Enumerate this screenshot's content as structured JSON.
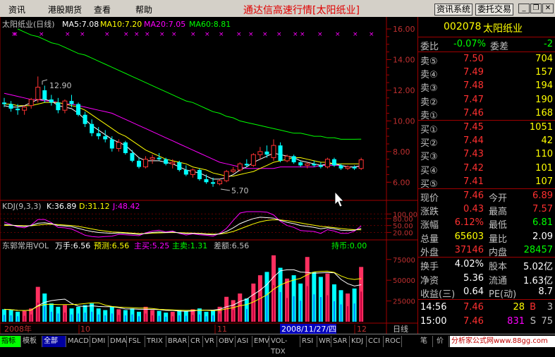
{
  "menubar": {
    "items": [
      "资讯",
      "港股期货",
      "查看",
      "帮助"
    ],
    "title": "通达信高速行情",
    "title_bracket": "[太阳纸业]",
    "btn_info": "资讯系统",
    "btn_trade": "委托交易"
  },
  "chart": {
    "main_label": "太阳纸业(日线)",
    "ma5": "MA5:7.08",
    "ma10": "MA10:7.20",
    "ma20": "MA20:7.05",
    "ma60": "MA60:8.81",
    "high_mark": "12.90",
    "low_mark": "5.70",
    "kdj_label": "KDJ(9,3,3)",
    "kdj_k": "K:36.89",
    "kdj_d": "D:31.12",
    "kdj_j": "J:48.42",
    "vol_name": "东郭常用VOL",
    "vol_wanshou": "万手:6.56",
    "vol_forecast": "预测:6.56",
    "vol_mainbuy": "主买:5.25",
    "vol_mainsell": "主卖:1.31",
    "vol_diff": "差额:6.56",
    "holding": "持币:0.00",
    "bottom_labels": {
      "y2008": "2008年",
      "m10": "10",
      "m11": "11",
      "cursor_date": "2008/11/27/四",
      "m12": "12",
      "period": "日线"
    },
    "colors": {
      "up": "#ff3333",
      "down": "#00ffff",
      "ma5": "#ffffff",
      "ma10": "#ffff00",
      "ma20": "#ff00ff",
      "ma60": "#00ff00",
      "axis": "#a00000",
      "axis_text": "#c03030"
    }
  },
  "chart_data": {
    "type": "candlestick",
    "price_axis": {
      "ticks": [
        "16.00",
        "14.00",
        "12.00",
        "10.00",
        "8.00",
        "6.00"
      ],
      "ylim": [
        5.0,
        16.6
      ]
    },
    "kdj_axis": {
      "ticks": [
        "100.00",
        "80.00",
        "50.00",
        "20.00"
      ],
      "ylim": [
        0,
        110
      ]
    },
    "vol_axis": {
      "ticks": [
        "75000",
        "50000",
        "25000"
      ],
      "ylim": [
        0,
        85000
      ]
    },
    "candles": [
      [
        11.2,
        11.5,
        10.9,
        11.1
      ],
      [
        11.1,
        11.3,
        10.6,
        10.8
      ],
      [
        10.8,
        11.1,
        10.4,
        10.7
      ],
      [
        10.7,
        11.0,
        10.4,
        10.9
      ],
      [
        11.0,
        11.5,
        10.8,
        11.4
      ],
      [
        11.4,
        12.9,
        11.2,
        12.2
      ],
      [
        12.0,
        12.3,
        11.2,
        11.4
      ],
      [
        11.4,
        11.7,
        11.0,
        11.2
      ],
      [
        11.2,
        11.5,
        10.5,
        10.7
      ],
      [
        10.7,
        11.4,
        10.5,
        11.3
      ],
      [
        11.3,
        11.7,
        10.9,
        11.1
      ],
      [
        11.1,
        11.2,
        10.3,
        10.4
      ],
      [
        10.4,
        10.6,
        9.6,
        9.8
      ],
      [
        9.8,
        10.1,
        9.0,
        9.2
      ],
      [
        9.2,
        9.6,
        8.8,
        9.0
      ],
      [
        9.0,
        9.4,
        8.6,
        8.8
      ],
      [
        8.8,
        9.0,
        8.0,
        8.2
      ],
      [
        8.2,
        8.8,
        8.0,
        8.6
      ],
      [
        8.6,
        8.7,
        7.8,
        7.9
      ],
      [
        7.9,
        8.1,
        7.3,
        7.4
      ],
      [
        7.4,
        7.6,
        6.9,
        7.0
      ],
      [
        7.0,
        7.7,
        6.9,
        7.5
      ],
      [
        7.5,
        7.8,
        7.2,
        7.6
      ],
      [
        7.6,
        7.9,
        7.4,
        7.5
      ],
      [
        7.5,
        7.6,
        7.1,
        7.2
      ],
      [
        7.2,
        7.5,
        6.9,
        7.3
      ],
      [
        7.3,
        7.4,
        6.7,
        6.8
      ],
      [
        6.8,
        7.1,
        6.4,
        6.5
      ],
      [
        6.5,
        6.9,
        6.3,
        6.8
      ],
      [
        6.8,
        6.9,
        6.1,
        6.2
      ],
      [
        6.2,
        6.5,
        5.9,
        6.0
      ],
      [
        6.0,
        6.3,
        5.7,
        5.9
      ],
      [
        5.9,
        6.2,
        5.8,
        6.1
      ],
      [
        6.1,
        6.8,
        6.0,
        6.7
      ],
      [
        6.7,
        7.0,
        6.6,
        6.8
      ],
      [
        6.8,
        7.3,
        6.7,
        7.2
      ],
      [
        7.2,
        7.5,
        7.0,
        7.1
      ],
      [
        7.1,
        7.9,
        7.0,
        7.8
      ],
      [
        7.8,
        8.3,
        7.5,
        8.0
      ],
      [
        8.0,
        8.4,
        7.6,
        7.8
      ],
      [
        7.6,
        8.8,
        7.4,
        8.4
      ],
      [
        8.4,
        8.6,
        7.3,
        7.4
      ],
      [
        7.4,
        7.8,
        7.3,
        7.7
      ],
      [
        7.7,
        7.8,
        7.2,
        7.3
      ],
      [
        7.3,
        7.4,
        7.0,
        7.1
      ],
      [
        7.1,
        7.3,
        6.9,
        7.2
      ],
      [
        7.2,
        7.4,
        7.0,
        7.1
      ],
      [
        7.1,
        7.3,
        6.9,
        7.0
      ],
      [
        7.0,
        7.6,
        6.9,
        7.5
      ],
      [
        7.5,
        7.6,
        7.0,
        7.1
      ],
      [
        7.1,
        7.2,
        6.8,
        6.9
      ],
      [
        6.9,
        7.1,
        6.8,
        7.0
      ],
      [
        7.0,
        7.1,
        6.8,
        6.9
      ],
      [
        6.9,
        7.6,
        6.8,
        7.46
      ]
    ],
    "ma5": [
      11.0,
      10.9,
      10.9,
      11.0,
      11.2,
      11.4,
      11.4,
      11.3,
      11.0,
      10.9,
      10.8,
      10.5,
      10.1,
      9.7,
      9.4,
      9.1,
      8.8,
      8.6,
      8.4,
      8.0,
      7.6,
      7.4,
      7.4,
      7.4,
      7.3,
      7.2,
      7.0,
      6.8,
      6.7,
      6.6,
      6.4,
      6.2,
      6.2,
      6.3,
      6.5,
      6.8,
      7.0,
      7.3,
      7.5,
      7.7,
      7.9,
      7.8,
      7.7,
      7.6,
      7.4,
      7.3,
      7.2,
      7.1,
      7.2,
      7.2,
      7.1,
      7.0,
      7.0,
      7.08
    ],
    "ma10": [
      11.1,
      11.1,
      11.0,
      11.0,
      11.0,
      11.1,
      11.2,
      11.2,
      11.2,
      11.1,
      11.0,
      10.9,
      10.7,
      10.4,
      10.1,
      9.8,
      9.5,
      9.2,
      9.0,
      8.7,
      8.4,
      8.1,
      7.9,
      7.7,
      7.5,
      7.4,
      7.3,
      7.2,
      7.0,
      6.9,
      6.8,
      6.6,
      6.5,
      6.4,
      6.4,
      6.5,
      6.6,
      6.7,
      6.9,
      7.1,
      7.3,
      7.4,
      7.5,
      7.6,
      7.6,
      7.5,
      7.4,
      7.3,
      7.3,
      7.2,
      7.2,
      7.2,
      7.2,
      7.2
    ],
    "ma20": [
      11.8,
      11.7,
      11.6,
      11.5,
      11.4,
      11.4,
      11.3,
      11.3,
      11.2,
      11.1,
      11.1,
      11.0,
      10.9,
      10.8,
      10.7,
      10.6,
      10.5,
      10.3,
      10.1,
      9.9,
      9.7,
      9.5,
      9.3,
      9.1,
      8.9,
      8.7,
      8.5,
      8.3,
      8.1,
      7.9,
      7.7,
      7.5,
      7.3,
      7.2,
      7.1,
      7.0,
      6.9,
      6.9,
      6.9,
      6.9,
      6.9,
      7.0,
      7.0,
      7.0,
      7.0,
      7.0,
      7.0,
      7.1,
      7.1,
      7.1,
      7.1,
      7.0,
      7.0,
      7.05
    ],
    "ma60": [
      16.0,
      15.8,
      15.6,
      15.5,
      15.3,
      15.1,
      15.0,
      14.8,
      14.6,
      14.4,
      14.3,
      14.1,
      13.9,
      13.7,
      13.5,
      13.3,
      13.1,
      12.9,
      12.7,
      12.5,
      12.3,
      12.1,
      11.9,
      11.7,
      11.5,
      11.3,
      11.2,
      11.0,
      10.8,
      10.6,
      10.5,
      10.3,
      10.2,
      10.0,
      9.9,
      9.8,
      9.7,
      9.6,
      9.5,
      9.4,
      9.3,
      9.2,
      9.2,
      9.1,
      9.0,
      9.0,
      8.9,
      8.9,
      8.8,
      8.8,
      8.8,
      8.81
    ],
    "kdj_k": [
      55,
      52,
      48,
      46,
      50,
      60,
      62,
      58,
      50,
      48,
      45,
      38,
      30,
      24,
      20,
      18,
      16,
      18,
      16,
      14,
      12,
      16,
      20,
      22,
      20,
      22,
      18,
      15,
      16,
      14,
      12,
      10,
      14,
      24,
      40,
      58,
      70,
      80,
      86,
      84,
      82,
      72,
      64,
      58,
      50,
      46,
      42,
      36,
      40,
      36,
      30,
      28,
      30,
      36.89
    ],
    "kdj_d": [
      50,
      51,
      50,
      49,
      49,
      52,
      55,
      56,
      54,
      52,
      50,
      46,
      41,
      35,
      30,
      26,
      22,
      21,
      19,
      17,
      15,
      15,
      17,
      18,
      19,
      20,
      19,
      18,
      17,
      16,
      14,
      13,
      13,
      17,
      24,
      35,
      46,
      57,
      66,
      72,
      75,
      74,
      71,
      66,
      61,
      56,
      51,
      46,
      44,
      41,
      37,
      34,
      32,
      31.12
    ],
    "kdj_j": [
      65,
      54,
      44,
      40,
      52,
      76,
      76,
      62,
      42,
      40,
      35,
      22,
      8,
      2,
      0,
      2,
      4,
      12,
      10,
      8,
      6,
      18,
      26,
      30,
      22,
      26,
      16,
      9,
      14,
      10,
      8,
      4,
      16,
      38,
      72,
      104,
      110,
      110,
      110,
      108,
      96,
      68,
      50,
      42,
      28,
      26,
      24,
      16,
      32,
      26,
      16,
      16,
      26,
      48.42
    ],
    "volumes": [
      15000,
      14000,
      12000,
      13000,
      16000,
      42000,
      34000,
      22000,
      18000,
      20000,
      16000,
      18000,
      20000,
      22000,
      16000,
      14000,
      18000,
      15000,
      14000,
      16000,
      12000,
      18000,
      14000,
      13000,
      11000,
      12000,
      14000,
      13000,
      15000,
      16000,
      12000,
      14000,
      18000,
      30000,
      26000,
      34000,
      28000,
      46000,
      56000,
      60000,
      80000,
      65000,
      52000,
      56000,
      46000,
      78000,
      60000,
      54000,
      58000,
      45000,
      38000,
      34000,
      40000,
      66000
    ]
  },
  "panel": {
    "code": "002078",
    "name": "太阳纸业",
    "weibi_label": "委比",
    "weibi_value": "-0.07%",
    "weicha_label": "委差",
    "weicha_value": "-2",
    "sell": [
      {
        "label": "卖⑤",
        "price": "7.50",
        "vol": "704"
      },
      {
        "label": "卖④",
        "price": "7.49",
        "vol": "157"
      },
      {
        "label": "卖③",
        "price": "7.48",
        "vol": "194"
      },
      {
        "label": "卖②",
        "price": "7.47",
        "vol": "190"
      },
      {
        "label": "卖①",
        "price": "7.46",
        "vol": "168"
      }
    ],
    "buy": [
      {
        "label": "买①",
        "price": "7.45",
        "vol": "1051"
      },
      {
        "label": "买②",
        "price": "7.44",
        "vol": "42"
      },
      {
        "label": "买③",
        "price": "7.43",
        "vol": "110"
      },
      {
        "label": "买④",
        "price": "7.42",
        "vol": "101"
      },
      {
        "label": "买⑤",
        "price": "7.41",
        "vol": "107"
      }
    ],
    "stats": [
      {
        "l1": "现价",
        "v1": "7.46",
        "l2": "今开",
        "v2": "6.89"
      },
      {
        "l1": "涨跌",
        "v1": "0.43",
        "l2": "最高",
        "v2": "7.57"
      },
      {
        "l1": "涨幅",
        "v1": "6.12%",
        "l2": "最低",
        "v2": "6.81"
      },
      {
        "l1": "总量",
        "v1": "65603",
        "l2": "量比",
        "v2": "2.09"
      },
      {
        "l1": "外盘",
        "v1": "37146",
        "l2": "内盘",
        "v2": "28457"
      }
    ],
    "fund": [
      {
        "l1": "换手",
        "v1": "4.02%",
        "l2": "股本",
        "v2": "5.02亿"
      },
      {
        "l1": "净资",
        "v1": "5.36",
        "l2": "流通",
        "v2": "1.63亿"
      },
      {
        "l1": "收益(三)",
        "v1": "0.64",
        "l2": "PE(动)",
        "v2": "8.7"
      }
    ],
    "ticks": [
      {
        "time": "14:56",
        "price": "7.46",
        "vol": "28",
        "dir": "B",
        "num": "3"
      },
      {
        "time": "15:00",
        "price": "7.46",
        "vol": "831",
        "dir": "S",
        "num": "75"
      }
    ]
  },
  "tabs": [
    "指标",
    "模板",
    "全部",
    "MACD",
    "DMI",
    "DMA",
    "FSL",
    "TRIX",
    "BRAR",
    "CR",
    "VR",
    "OBV",
    "ASI",
    "EMV",
    "VOL-TDX",
    "RSI",
    "WR",
    "SAR",
    "KDJ",
    "CCI",
    "ROC"
  ],
  "tabs_right": [
    "笔",
    "价"
  ],
  "watermark": "分析家公式网www.88gg.com"
}
